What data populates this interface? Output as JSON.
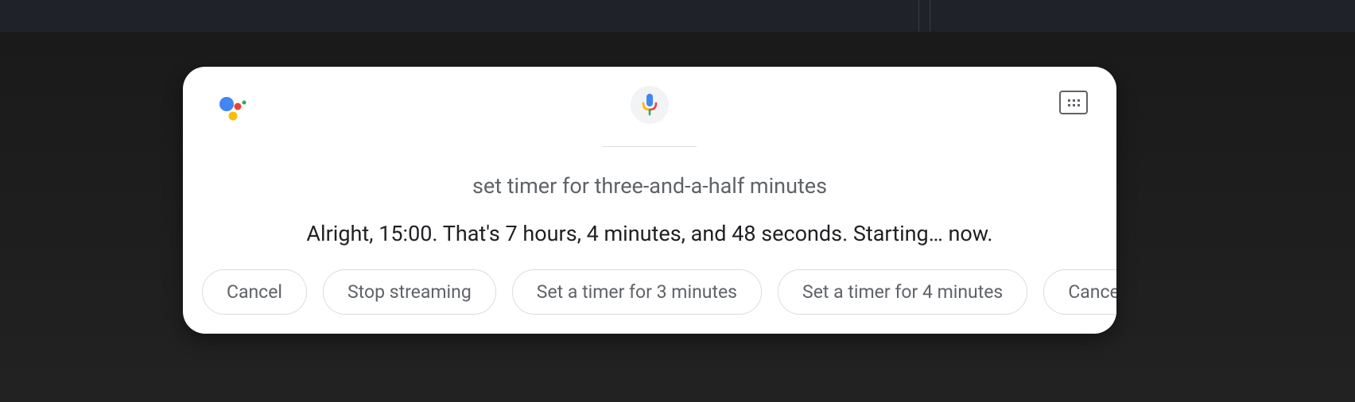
{
  "query": "set timer for three-and-a-half minutes",
  "response": "Alright, 15:00. That's 7 hours, 4 minutes, and 48 seconds. Starting… now.",
  "suggestions": [
    "Cancel",
    "Stop streaming",
    "Set a timer for 3 minutes",
    "Set a timer for 4 minutes",
    "Cancel"
  ]
}
